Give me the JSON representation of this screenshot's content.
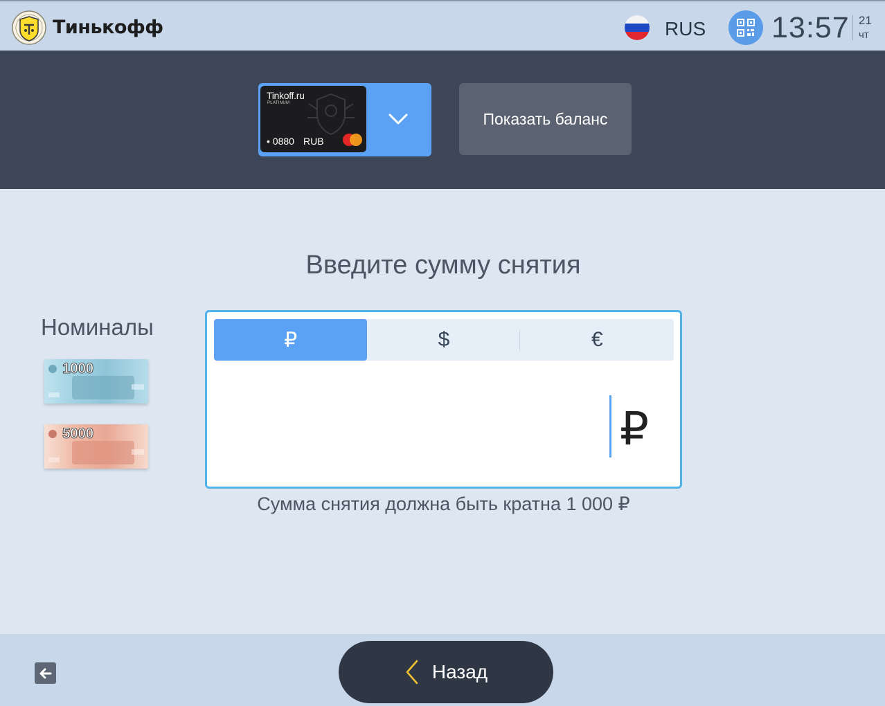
{
  "header": {
    "brand_name": "Тинькофф",
    "language": "RUS",
    "time": "13:57",
    "date_day": "21",
    "date_weekday": "чт",
    "qr_icon": "qr-code-icon",
    "flag_icon": "russia-flag-icon"
  },
  "account": {
    "card_brand": "Tinkoff.ru",
    "card_tier": "PLATINUM",
    "card_number": "• 0880",
    "card_currency": "RUB",
    "payment_system_icon": "mastercard-icon",
    "dropdown_icon": "chevron-down-icon",
    "show_balance_label": "Показать баланс"
  },
  "main": {
    "heading": "Введите сумму снятия",
    "denominations_title": "Номиналы",
    "denominations": [
      {
        "value": "1000"
      },
      {
        "value": "5000"
      }
    ],
    "currency_tabs": [
      {
        "label": "₽",
        "active": true
      },
      {
        "label": "$",
        "active": false
      },
      {
        "label": "€",
        "active": false
      }
    ],
    "amount_value": "",
    "amount_currency_sign": "₽",
    "hint": "Сумма снятия должна быть кратна 1 000 ₽"
  },
  "footer": {
    "exit_icon": "exit-arrow-icon",
    "back_label": "Назад",
    "back_icon": "chevron-left-icon"
  },
  "colors": {
    "accent_blue": "#5ba2f5",
    "panel_border": "#4fb3ea",
    "dark_band": "#3d4658",
    "top_bar": "#c8d8ea",
    "back_chevron": "#f2c230"
  }
}
